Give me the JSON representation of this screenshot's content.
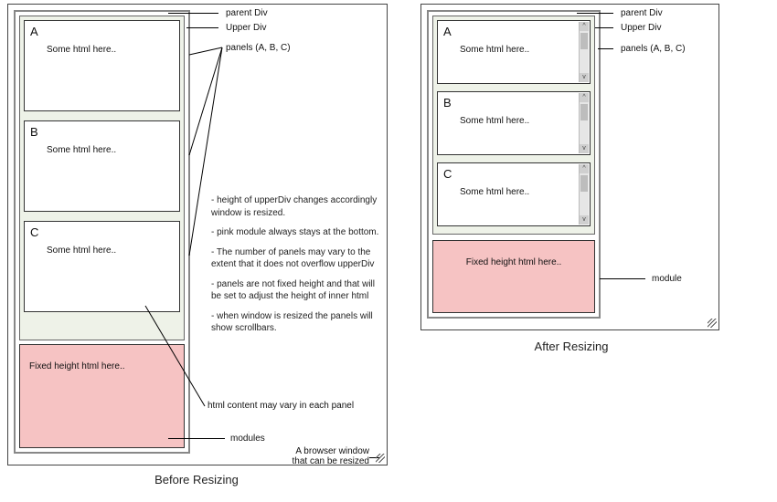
{
  "left": {
    "caption": "Before Resizing",
    "panels": [
      {
        "tag": "A",
        "body": "Some html here.."
      },
      {
        "tag": "B",
        "body": "Some html here.."
      },
      {
        "tag": "C",
        "body": "Some html here.."
      }
    ],
    "module_text": "Fixed height html here..",
    "labels": {
      "parent": "parent Div",
      "upper": "Upper Div",
      "panels": "panels  (A, B, C)",
      "notes": [
        "- height of upperDiv changes accordingly window is resized.",
        "- pink module always stays at the bottom.",
        "- The number of panels may vary to the extent that it does not overflow upperDiv",
        "- panels are not fixed height and that will be set to adjust the height of inner html",
        "- when window is resized the panels will show scrollbars."
      ],
      "html_vary": "html content may vary in each panel",
      "modules": "modules",
      "resize": "A browser window\nthat can be resized"
    }
  },
  "right": {
    "caption": "After Resizing",
    "panels": [
      {
        "tag": "A",
        "body": "Some html here.."
      },
      {
        "tag": "B",
        "body": "Some html here.."
      },
      {
        "tag": "C",
        "body": "Some html here.."
      }
    ],
    "module_text": "Fixed height html here..",
    "labels": {
      "parent": "parent Div",
      "upper": "Upper Div",
      "panels": "panels  (A, B, C)",
      "module": "module"
    }
  }
}
